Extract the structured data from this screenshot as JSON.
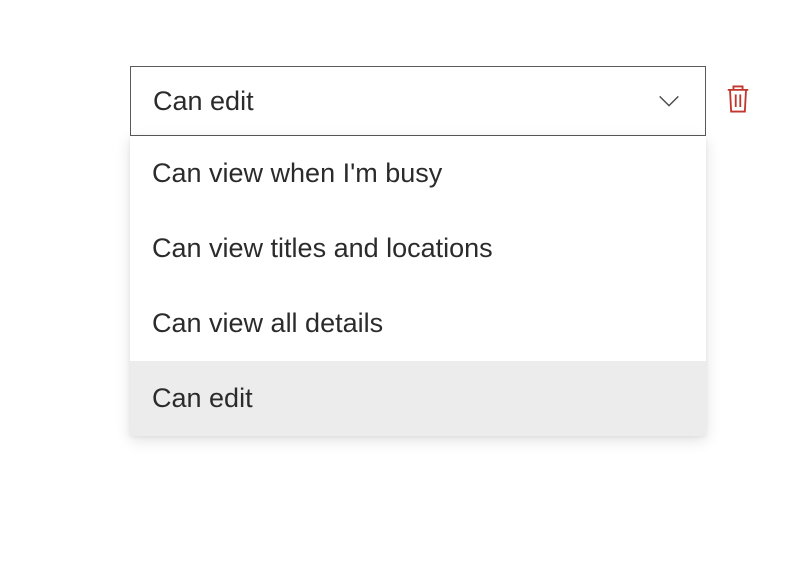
{
  "permission_select": {
    "selected_value": "Can edit",
    "options": [
      {
        "label": "Can view when I'm busy",
        "selected": false
      },
      {
        "label": "Can view titles and locations",
        "selected": false
      },
      {
        "label": "Can view all details",
        "selected": false
      },
      {
        "label": "Can edit",
        "selected": true
      }
    ]
  },
  "colors": {
    "delete_icon": "#c2362c",
    "border": "#5a5a5a",
    "text": "#2b2b2b",
    "selected_bg": "#ececec"
  }
}
